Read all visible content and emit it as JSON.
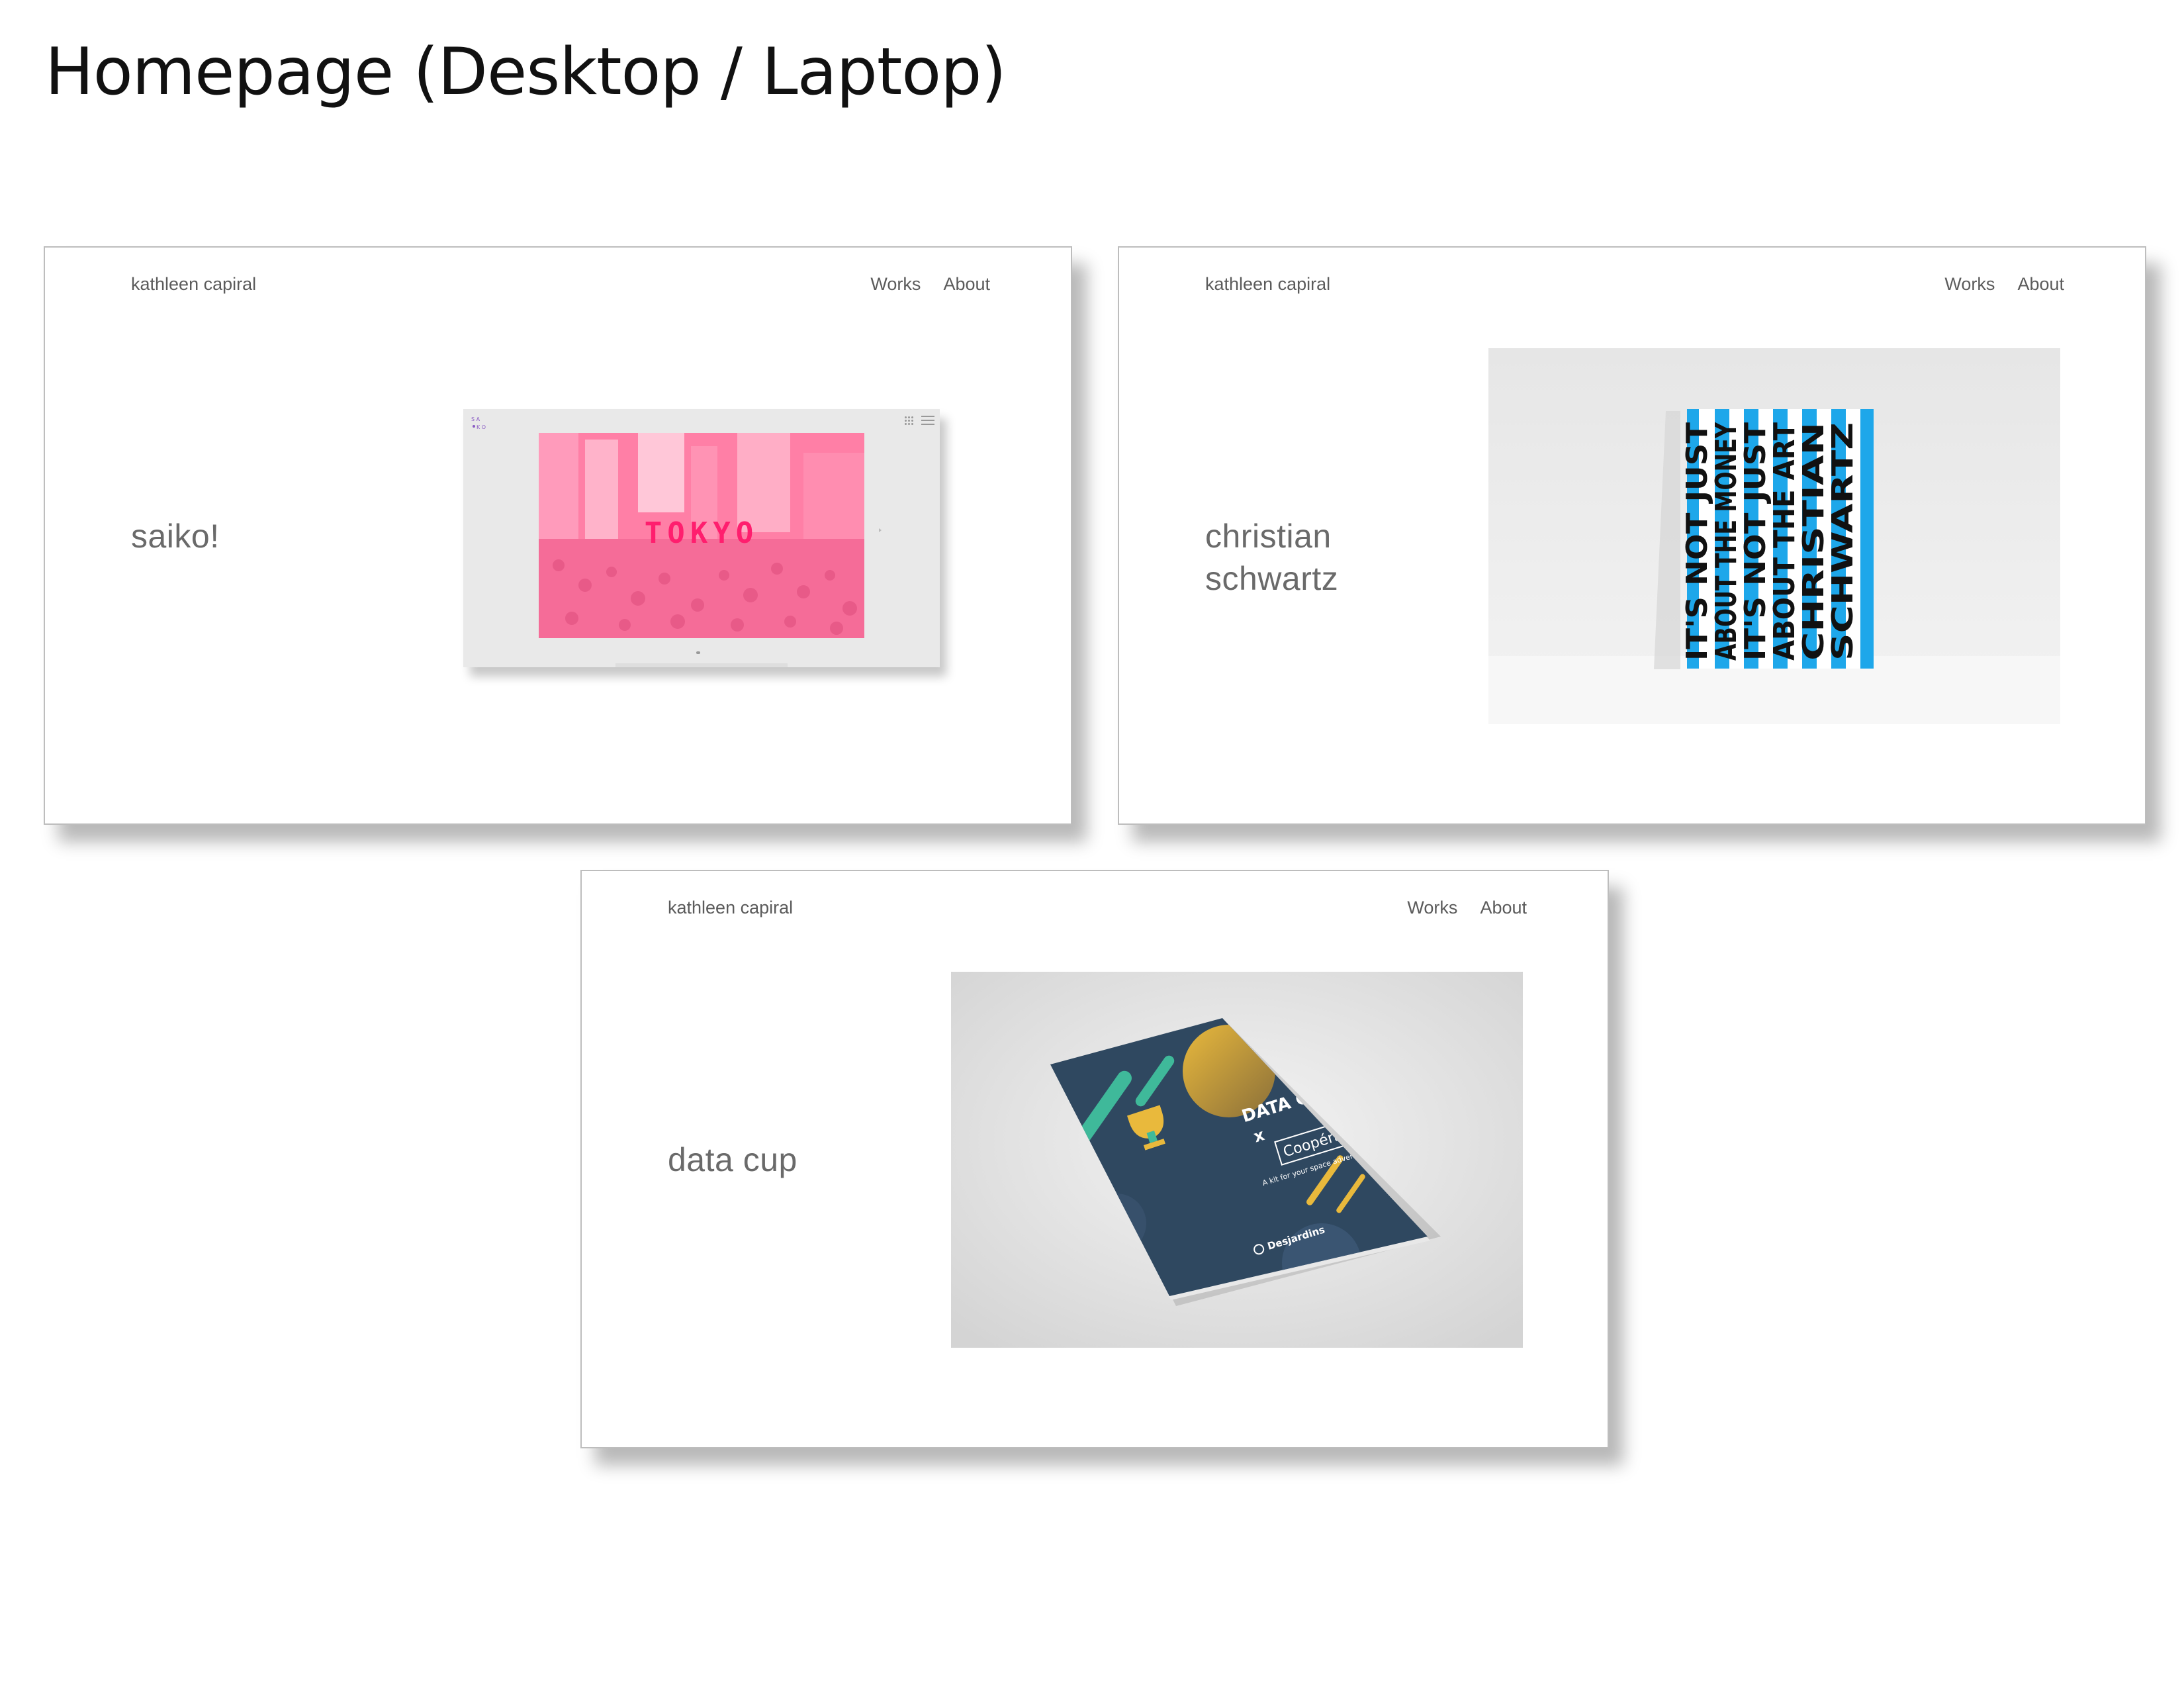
{
  "page": {
    "title": "Homepage (Desktop / Laptop)"
  },
  "frames": [
    {
      "site_name": "kathleen capiral",
      "nav": [
        "Works",
        "About"
      ],
      "project_title": [
        "saiko!"
      ],
      "thumbnail": {
        "word": "TOKYO",
        "accent_color": "#ff1e6e"
      }
    },
    {
      "site_name": "kathleen capiral",
      "nav": [
        "Works",
        "About"
      ],
      "project_title": [
        "christian",
        "schwartz"
      ],
      "thumbnail": {
        "poster_lines": [
          "IT'S NOT JUST",
          "ABOUT THE MONEY",
          "IT'S NOT JUST",
          "ABOUT THE ART",
          "CHRISTIAN",
          "SCHWARTZ"
        ],
        "stripe_color": "#1ea7ea"
      }
    },
    {
      "site_name": "kathleen capiral",
      "nav": [
        "Works",
        "About"
      ],
      "project_title": [
        "data cup"
      ],
      "thumbnail": {
        "headline": "DATA CUP",
        "cross": "x",
        "partner": "Coopérathon",
        "tagline": "A kit for your space adventure",
        "sponsor": "Desjardins",
        "cover_color": "#2f4860"
      }
    }
  ]
}
